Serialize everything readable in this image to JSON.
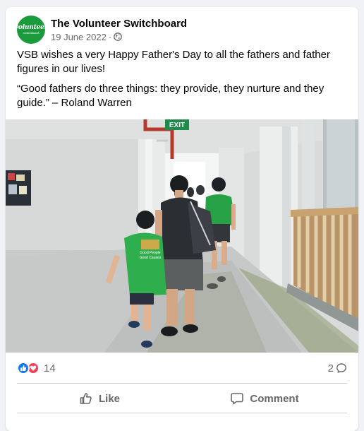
{
  "post": {
    "page_name": "The Volunteer Switchboard",
    "avatar_text": "volunteer",
    "avatar_subtext": "switchboard",
    "date": "19 June 2022",
    "separator": "·",
    "privacy_icon": "globe-icon",
    "paragraph_1": "VSB wishes a very Happy Father's Day to all the fathers and father figures in our lives!",
    "paragraph_2": "“Good fathers do three things: they provide, they nurture and they guide.” – Roland Warren"
  },
  "photo": {
    "exit_sign": "EXIT",
    "shirt_text_1": "Good People",
    "shirt_text_2": "Good Causes"
  },
  "reactions": {
    "icons": [
      "like-icon",
      "love-icon"
    ],
    "count": "14",
    "comments": "2"
  },
  "actions": {
    "like_label": "Like",
    "comment_label": "Comment"
  },
  "colors": {
    "brand_green": "#1a9a3b",
    "like_blue": "#1877f2",
    "love_red": "#f33e58",
    "secondary_text": "#65676b"
  }
}
